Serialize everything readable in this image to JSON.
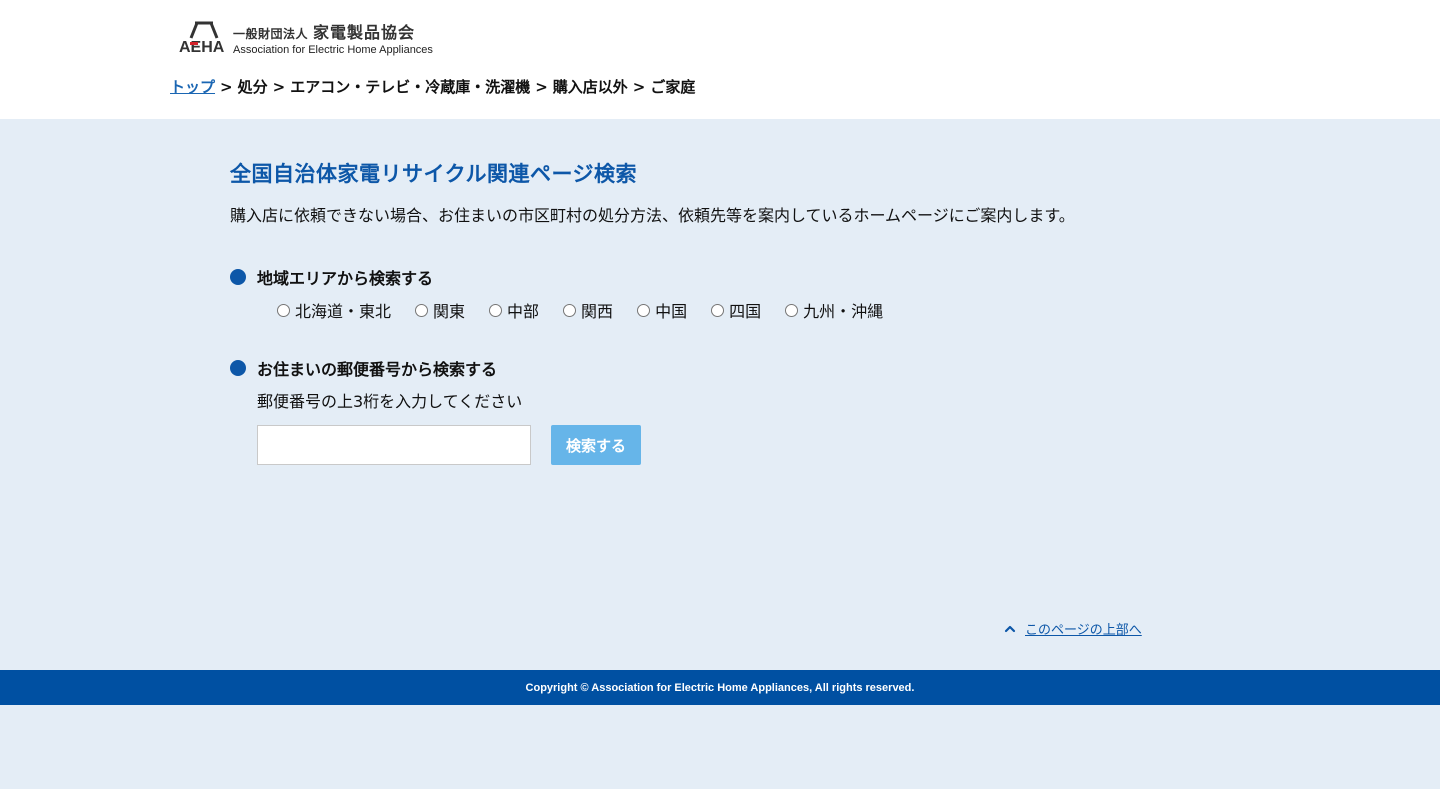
{
  "header": {
    "logo": {
      "mark_text": "AEHA",
      "org_small": "一般財団法人",
      "org_name": "家電製品協会",
      "org_en": "Association for Electric Home Appliances"
    },
    "breadcrumb": {
      "items": [
        "トップ",
        "処分",
        "エアコン・テレビ・冷蔵庫・洗濯機",
        "購入店以外",
        "ご家庭"
      ],
      "separator": ">"
    }
  },
  "main": {
    "title": "全国自治体家電リサイクル関連ページ検索",
    "lead": "購入店に依頼できない場合、お住まいの市区町村の処分方法、依頼先等を案内しているホームページにご案内します。",
    "area_search": {
      "heading": "地域エリアから検索する",
      "options": [
        "北海道・東北",
        "関東",
        "中部",
        "関西",
        "中国",
        "四国",
        "九州・沖縄"
      ]
    },
    "postal_search": {
      "heading": "お住まいの郵便番号から検索する",
      "hint": "郵便番号の上3桁を入力してください",
      "input_value": "",
      "button_label": "検索する"
    }
  },
  "to_top_label": "このページの上部へ",
  "footer": {
    "copyright": "Copyright © Association for Electric Home Appliances, All rights reserved."
  },
  "colors": {
    "accent": "#0d57a8",
    "link": "#1a66b3",
    "background": "#e4edf6",
    "footer_bg": "#0050a2",
    "button_bg": "#66b5e9"
  }
}
